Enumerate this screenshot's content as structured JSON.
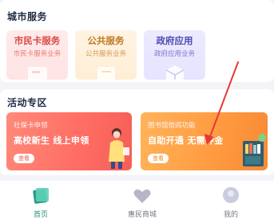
{
  "city_services": {
    "title": "城市服务",
    "cards": [
      {
        "title": "市民卡服务",
        "subtitle": "市民卡服务业务"
      },
      {
        "title": "公共服务",
        "subtitle": "公共服务业务"
      },
      {
        "title": "政府应用",
        "subtitle": "政府应用业务"
      }
    ]
  },
  "activity": {
    "title": "活动专区",
    "banners": [
      {
        "small": "社保卡申领",
        "big": "高校新生 线上申领",
        "button": "查看"
      },
      {
        "small": "图书馆借阅功能",
        "big": "自助开通 无需押金",
        "button": "查看"
      }
    ]
  },
  "tabbar": {
    "items": [
      {
        "label": "首页"
      },
      {
        "label": "惠民商城"
      },
      {
        "label": "我的"
      }
    ]
  },
  "colors": {
    "accent": "#2a8c7a",
    "annotation": "#e53935"
  },
  "icons": [
    "card-icon",
    "document-icon",
    "cube-icon",
    "person-illustration",
    "bookshelf-illustration",
    "home-tab-icon",
    "heart-tab-icon",
    "profile-tab-icon"
  ]
}
